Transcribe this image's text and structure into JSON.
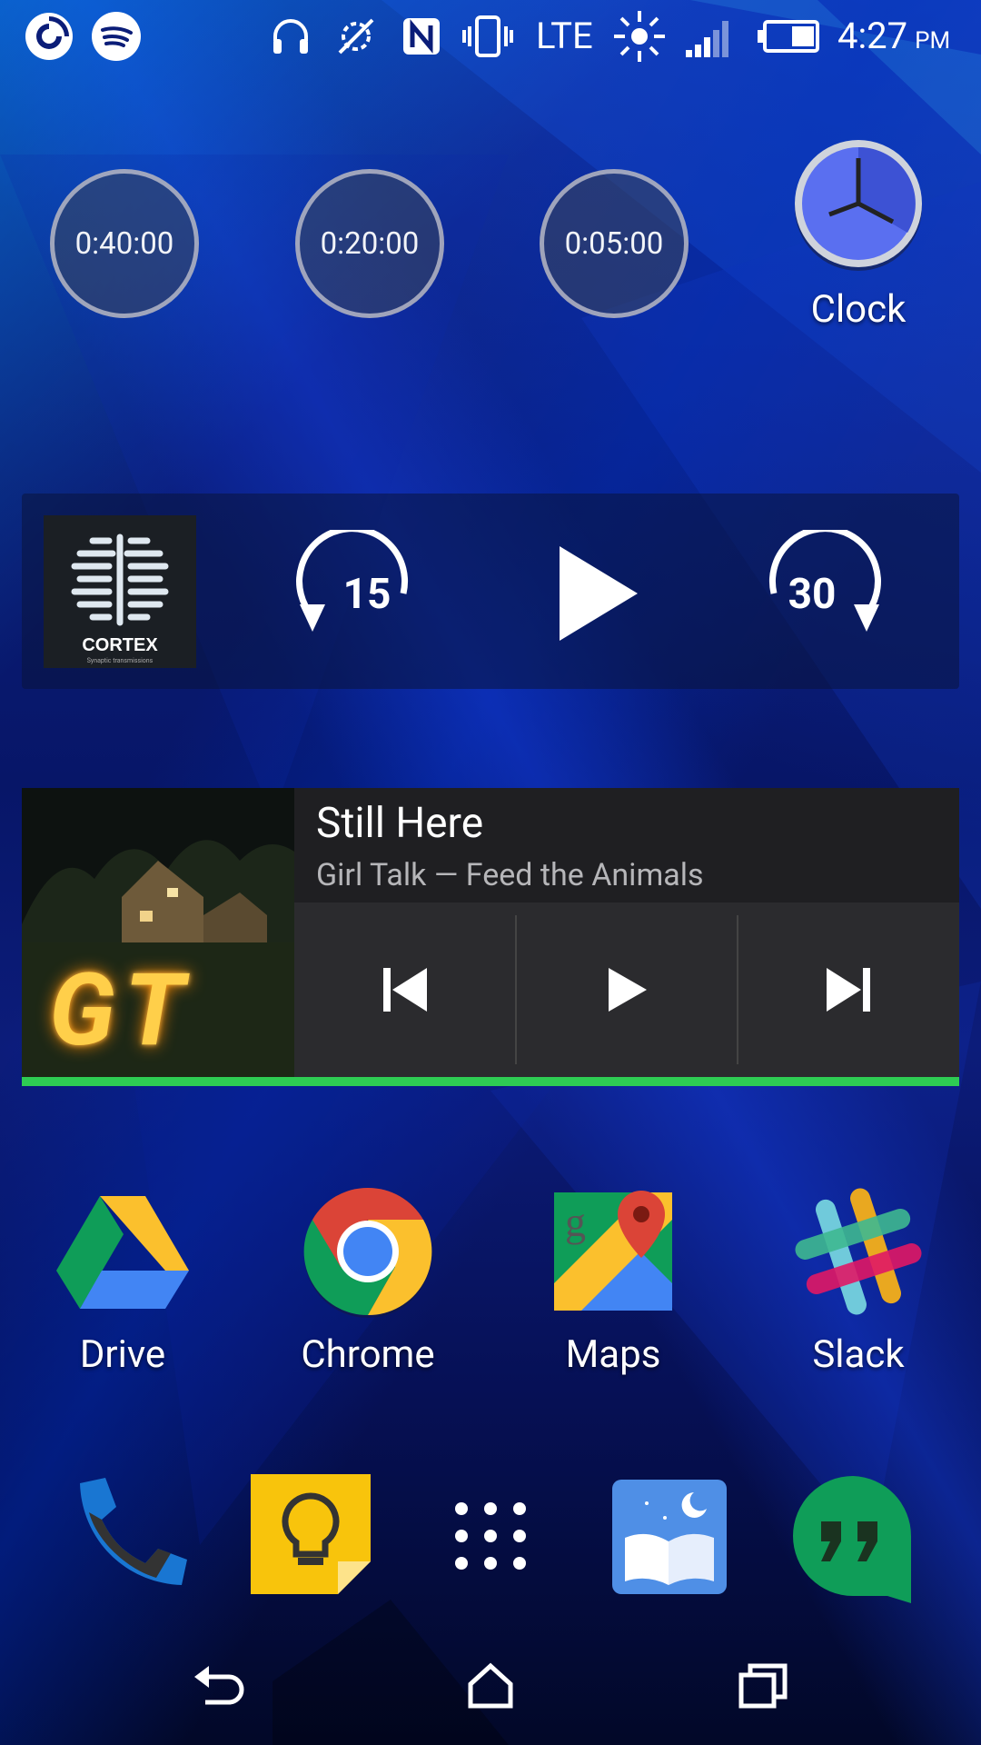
{
  "status_bar": {
    "time": "4:27",
    "ampm": "PM",
    "network": "LTE",
    "icons": [
      "pocket-casts-icon",
      "spotify-icon",
      "headset-icon",
      "data-saver-icon",
      "nfc-icon",
      "vibrate-icon",
      "lte-icon",
      "brightness-icon",
      "signal-icon",
      "battery-icon"
    ]
  },
  "timers": {
    "t1": "0:40:00",
    "t2": "0:20:00",
    "t3": "0:05:00"
  },
  "clock_app": {
    "label": "Clock"
  },
  "podcast_widget": {
    "artwork_title": "CORTEX",
    "artwork_subtitle": "Synaptic transmissions",
    "skip_back_seconds": "15",
    "skip_forward_seconds": "30"
  },
  "music_widget": {
    "title": "Still Here",
    "subtitle": "Girl Talk — Feed the Animals",
    "artwork_text": "GT",
    "accent_color": "#2ecc53"
  },
  "apps": {
    "drive": "Drive",
    "chrome": "Chrome",
    "maps": "Maps",
    "slack": "Slack"
  },
  "dock": {
    "icons": [
      "phone-icon",
      "keep-icon",
      "app-drawer-icon",
      "moon-reader-icon",
      "hangouts-icon"
    ]
  }
}
